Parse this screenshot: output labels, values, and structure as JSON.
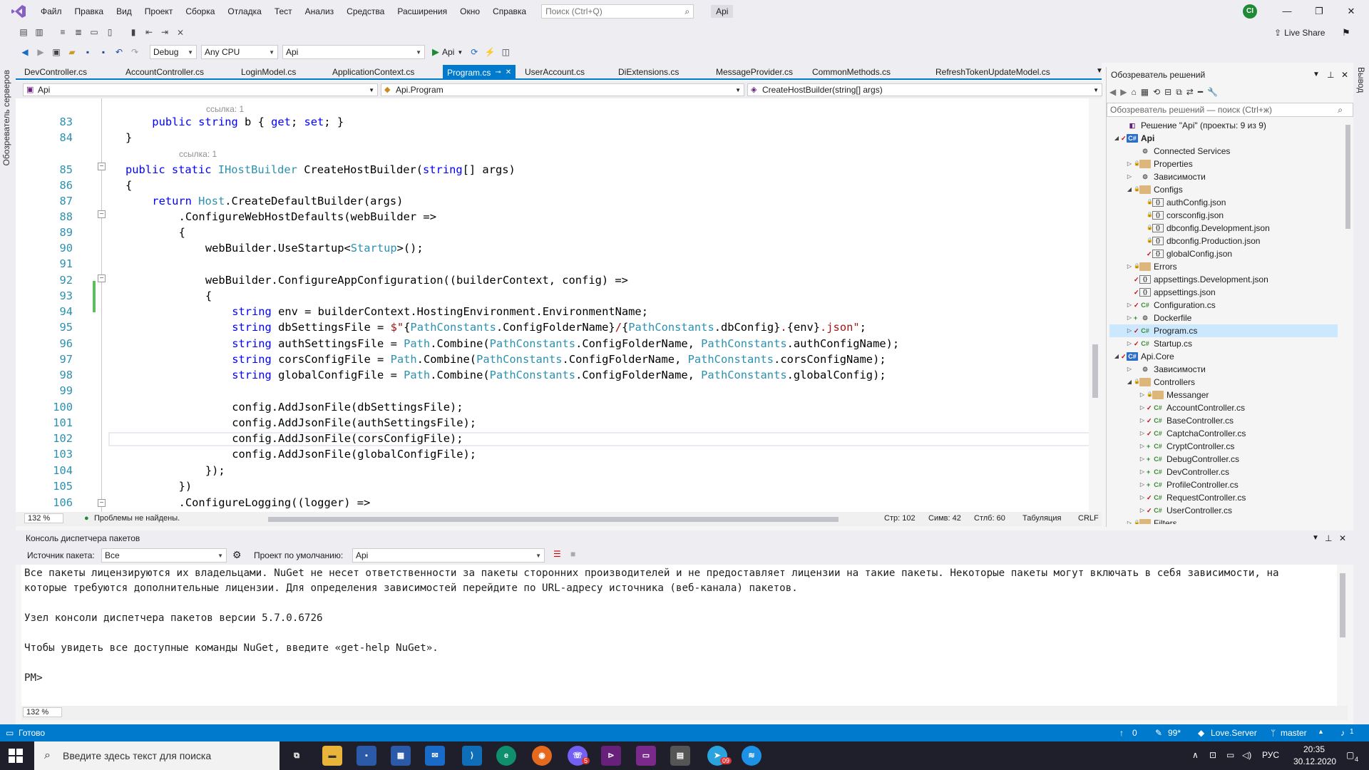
{
  "menu": {
    "items": [
      "Файл",
      "Правка",
      "Вид",
      "Проект",
      "Сборка",
      "Отладка",
      "Тест",
      "Анализ",
      "Средства",
      "Расширения",
      "Окно",
      "Справка"
    ],
    "search_placeholder": "Поиск (Ctrl+Q)",
    "solution_name": "Api",
    "user_initials": "CI"
  },
  "toolbar": {
    "config": "Debug",
    "platform": "Any CPU",
    "startup_project": "Api",
    "run_label": "Api",
    "live_share": "Live Share"
  },
  "side_labels": {
    "left": "Обозреватель серверов",
    "right": "Вывод"
  },
  "doc_tabs": [
    "DevController.cs",
    "AccountController.cs",
    "LoginModel.cs",
    "ApplicationContext.cs",
    "Program.cs",
    "UserAccount.cs",
    "DiExtensions.cs",
    "MessageProvider.cs",
    "CommonMethods.cs",
    "RefreshTokenUpdateModel.cs"
  ],
  "active_tab": "Program.cs",
  "nav_bar": {
    "project": "Api",
    "class": "Api.Program",
    "member": "CreateHostBuilder(string[] args)"
  },
  "code": {
    "ref_83": "ссылка: 1",
    "ref_85": "ссылка: 1",
    "lines": [
      {
        "n": "83",
        "parts": [
          [
            "kw",
            "public "
          ],
          [
            "kw",
            "string "
          ],
          [
            "",
            "b { "
          ],
          [
            "kw",
            "get"
          ],
          [
            "",
            "; "
          ],
          [
            "kw",
            "set"
          ],
          [
            "",
            "; }"
          ]
        ],
        "indent": 2
      },
      {
        "n": "84",
        "parts": [
          [
            "",
            "}"
          ]
        ],
        "indent": 1
      },
      {
        "n": "85",
        "parts": [
          [
            "kw",
            "public "
          ],
          [
            "kw",
            "static "
          ],
          [
            "ty",
            "IHostBuilder "
          ],
          [
            "",
            "CreateHostBuilder("
          ],
          [
            "kw",
            "string"
          ],
          [
            "",
            "[] args)"
          ]
        ],
        "indent": 1
      },
      {
        "n": "86",
        "parts": [
          [
            "",
            "{"
          ]
        ],
        "indent": 1
      },
      {
        "n": "87",
        "parts": [
          [
            "kw",
            "return "
          ],
          [
            "ty",
            "Host"
          ],
          [
            "",
            ".CreateDefaultBuilder(args)"
          ]
        ],
        "indent": 2
      },
      {
        "n": "88",
        "parts": [
          [
            "",
            ".ConfigureWebHostDefaults(webBuilder =>"
          ]
        ],
        "indent": 3
      },
      {
        "n": "89",
        "parts": [
          [
            "",
            "{"
          ]
        ],
        "indent": 3
      },
      {
        "n": "90",
        "parts": [
          [
            "",
            "webBuilder.UseStartup<"
          ],
          [
            "ty",
            "Startup"
          ],
          [
            "",
            ">();"
          ]
        ],
        "indent": 4
      },
      {
        "n": "91",
        "parts": [],
        "indent": 0
      },
      {
        "n": "92",
        "parts": [
          [
            "",
            "webBuilder.ConfigureAppConfiguration((builderContext, config) =>"
          ]
        ],
        "indent": 4
      },
      {
        "n": "93",
        "parts": [
          [
            "",
            "{"
          ]
        ],
        "indent": 4
      },
      {
        "n": "94",
        "parts": [
          [
            "kw",
            "string "
          ],
          [
            "",
            "env = builderContext.HostingEnvironment.EnvironmentName;"
          ]
        ],
        "indent": 5
      },
      {
        "n": "95",
        "parts": [
          [
            "kw",
            "string "
          ],
          [
            "",
            "dbSettingsFile = "
          ],
          [
            "str",
            "$\""
          ],
          [
            "",
            "{"
          ],
          [
            "ty",
            "PathConstants"
          ],
          [
            "",
            ".ConfigFolderName}"
          ],
          [
            "str",
            "/"
          ],
          [
            "",
            "{"
          ],
          [
            "ty",
            "PathConstants"
          ],
          [
            "",
            ".dbConfig}"
          ],
          [
            "str",
            "."
          ],
          [
            "",
            "{env}"
          ],
          [
            "str",
            ".json\""
          ],
          [
            "",
            ";"
          ]
        ],
        "indent": 5
      },
      {
        "n": "96",
        "parts": [
          [
            "kw",
            "string "
          ],
          [
            "",
            "authSettingsFile = "
          ],
          [
            "ty",
            "Path"
          ],
          [
            "",
            ".Combine("
          ],
          [
            "ty",
            "PathConstants"
          ],
          [
            "",
            ".ConfigFolderName, "
          ],
          [
            "ty",
            "PathConstants"
          ],
          [
            "",
            ".authConfigName);"
          ]
        ],
        "indent": 5
      },
      {
        "n": "97",
        "parts": [
          [
            "kw",
            "string "
          ],
          [
            "",
            "corsConfigFile = "
          ],
          [
            "ty",
            "Path"
          ],
          [
            "",
            ".Combine("
          ],
          [
            "ty",
            "PathConstants"
          ],
          [
            "",
            ".ConfigFolderName, "
          ],
          [
            "ty",
            "PathConstants"
          ],
          [
            "",
            ".corsConfigName);"
          ]
        ],
        "indent": 5
      },
      {
        "n": "98",
        "parts": [
          [
            "kw",
            "string "
          ],
          [
            "",
            "globalConfigFile = "
          ],
          [
            "ty",
            "Path"
          ],
          [
            "",
            ".Combine("
          ],
          [
            "ty",
            "PathConstants"
          ],
          [
            "",
            ".ConfigFolderName, "
          ],
          [
            "ty",
            "PathConstants"
          ],
          [
            "",
            ".globalConfig);"
          ]
        ],
        "indent": 5
      },
      {
        "n": "99",
        "parts": [],
        "indent": 0
      },
      {
        "n": "100",
        "parts": [
          [
            "",
            "config.AddJsonFile(dbSettingsFile);"
          ]
        ],
        "indent": 5
      },
      {
        "n": "101",
        "parts": [
          [
            "",
            "config.AddJsonFile(authSettingsFile);"
          ]
        ],
        "indent": 5
      },
      {
        "n": "102",
        "parts": [
          [
            "",
            "config.AddJsonFile(corsConfigFile);"
          ]
        ],
        "indent": 5
      },
      {
        "n": "103",
        "parts": [
          [
            "",
            "config.AddJsonFile(globalConfigFile);"
          ]
        ],
        "indent": 5
      },
      {
        "n": "104",
        "parts": [
          [
            "",
            "});"
          ]
        ],
        "indent": 4
      },
      {
        "n": "105",
        "parts": [
          [
            "",
            "})"
          ]
        ],
        "indent": 3
      },
      {
        "n": "106",
        "parts": [
          [
            "",
            ".ConfigureLogging((logger) =>"
          ]
        ],
        "indent": 3
      }
    ]
  },
  "editor_status": {
    "zoom": "132 %",
    "issues": "Проблемы не найдены.",
    "line": "Стр: 102",
    "char": "Симв: 42",
    "col": "Стлб: 60",
    "tabs": "Табуляция",
    "eol": "CRLF"
  },
  "package_console": {
    "title": "Консоль диспетчера пакетов",
    "source_label": "Источник пакета:",
    "source_value": "Все",
    "project_label": "Проект по умолчанию:",
    "project_value": "Api",
    "lines": [
      "Все пакеты лицензируются их владельцами. NuGet не несет ответственности за пакеты сторонних производителей и не предоставляет лицензии на такие пакеты. Некоторые пакеты могут включать в себя зависимости, на",
      "которые требуются дополнительные лицензии. Для определения зависимостей перейдите по URL-адресу источника (веб-канала) пакетов.",
      "",
      "Узел консоли диспетчера пакетов версии 5.7.0.6726",
      "",
      "Чтобы увидеть все доступные команды NuGet, введите «get-help NuGet».",
      "",
      "PM>"
    ],
    "zoom": "132 %"
  },
  "solution_explorer": {
    "title": "Обозреватель решений",
    "search_placeholder": "Обозреватель решений — поиск (Ctrl+ж)",
    "nodes": [
      {
        "label": "Решение \"Api\" (проекты: 9 из 9)",
        "level": 0,
        "exp": "",
        "st": "",
        "icon": "sol",
        "bold": false
      },
      {
        "label": "Api",
        "level": 0,
        "exp": "◢",
        "st": "✓",
        "icon": "proj",
        "bold": true
      },
      {
        "label": "Connected Services",
        "level": 1,
        "exp": "",
        "st": "",
        "icon": "svc",
        "bold": false
      },
      {
        "label": "Properties",
        "level": 1,
        "exp": "▷",
        "st": "🔒",
        "icon": "folder",
        "bold": false
      },
      {
        "label": "Зависимости",
        "level": 1,
        "exp": "▷",
        "st": "",
        "icon": "svc",
        "bold": false
      },
      {
        "label": "Configs",
        "level": 1,
        "exp": "◢",
        "st": "🔒",
        "icon": "folder",
        "bold": false
      },
      {
        "label": "authConfig.json",
        "level": 2,
        "exp": "",
        "st": "🔒",
        "icon": "json",
        "bold": false
      },
      {
        "label": "corsconfig.json",
        "level": 2,
        "exp": "",
        "st": "🔒",
        "icon": "json",
        "bold": false
      },
      {
        "label": "dbconfig.Development.json",
        "level": 2,
        "exp": "",
        "st": "🔒",
        "icon": "json",
        "bold": false
      },
      {
        "label": "dbconfig.Production.json",
        "level": 2,
        "exp": "",
        "st": "🔒",
        "icon": "json",
        "bold": false
      },
      {
        "label": "globalConfig.json",
        "level": 2,
        "exp": "",
        "st": "✓",
        "icon": "json",
        "bold": false
      },
      {
        "label": "Errors",
        "level": 1,
        "exp": "▷",
        "st": "🔒",
        "icon": "folder",
        "bold": false
      },
      {
        "label": "appsettings.Development.json",
        "level": 1,
        "exp": "",
        "st": "✓",
        "icon": "json",
        "bold": false
      },
      {
        "label": "appsettings.json",
        "level": 1,
        "exp": "",
        "st": "✓",
        "icon": "json",
        "bold": false
      },
      {
        "label": "Configuration.cs",
        "level": 1,
        "exp": "▷",
        "st": "✓",
        "icon": "cs",
        "bold": false
      },
      {
        "label": "Dockerfile",
        "level": 1,
        "exp": "▷",
        "st": "+",
        "icon": "svc",
        "bold": false
      },
      {
        "label": "Program.cs",
        "level": 1,
        "exp": "▷",
        "st": "✓",
        "icon": "cs",
        "bold": false,
        "selected": true
      },
      {
        "label": "Startup.cs",
        "level": 1,
        "exp": "▷",
        "st": "✓",
        "icon": "cs",
        "bold": false
      },
      {
        "label": "Api.Core",
        "level": 0,
        "exp": "◢",
        "st": "✓",
        "icon": "proj",
        "bold": false
      },
      {
        "label": "Зависимости",
        "level": 1,
        "exp": "▷",
        "st": "",
        "icon": "svc",
        "bold": false
      },
      {
        "label": "Controllers",
        "level": 1,
        "exp": "◢",
        "st": "🔒",
        "icon": "folder",
        "bold": false
      },
      {
        "label": "Messanger",
        "level": 2,
        "exp": "▷",
        "st": "🔒",
        "icon": "folder",
        "bold": false
      },
      {
        "label": "AccountController.cs",
        "level": 2,
        "exp": "▷",
        "st": "✓",
        "icon": "cs",
        "bold": false
      },
      {
        "label": "BaseController.cs",
        "level": 2,
        "exp": "▷",
        "st": "✓",
        "icon": "cs",
        "bold": false
      },
      {
        "label": "CaptchaController.cs",
        "level": 2,
        "exp": "▷",
        "st": "✓",
        "icon": "cs",
        "bold": false
      },
      {
        "label": "CryptController.cs",
        "level": 2,
        "exp": "▷",
        "st": "+",
        "icon": "cs",
        "bold": false
      },
      {
        "label": "DebugController.cs",
        "level": 2,
        "exp": "▷",
        "st": "+",
        "icon": "cs",
        "bold": false
      },
      {
        "label": "DevController.cs",
        "level": 2,
        "exp": "▷",
        "st": "+",
        "icon": "cs",
        "bold": false
      },
      {
        "label": "ProfileController.cs",
        "level": 2,
        "exp": "▷",
        "st": "+",
        "icon": "cs",
        "bold": false
      },
      {
        "label": "RequestController.cs",
        "level": 2,
        "exp": "▷",
        "st": "✓",
        "icon": "cs",
        "bold": false
      },
      {
        "label": "UserController.cs",
        "level": 2,
        "exp": "▷",
        "st": "✓",
        "icon": "cs",
        "bold": false
      },
      {
        "label": "Filters",
        "level": 1,
        "exp": "▷",
        "st": "🔒",
        "icon": "folder",
        "bold": false
      }
    ]
  },
  "statusbar": {
    "ready": "Готово",
    "up_count": "0",
    "pencil_count": "99*",
    "repo": "Love.Server",
    "branch": "master",
    "notif": "1"
  },
  "taskbar": {
    "search_placeholder": "Введите здесь текст для поиска",
    "lang": "РУС",
    "time": "20:35",
    "date": "30.12.2020",
    "viber_badge": "5",
    "telegram_badge": "09",
    "notif_count": "4"
  },
  "colors": {
    "accent": "#007acc",
    "keyword": "#0000ff",
    "type": "#2b91af",
    "string": "#a31515"
  }
}
